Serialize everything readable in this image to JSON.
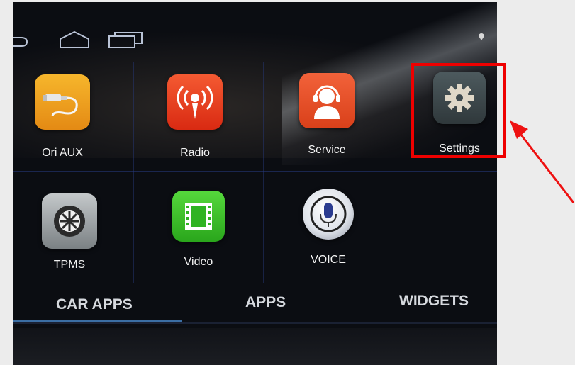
{
  "apps": [
    {
      "label": "Ori AUX",
      "icon": "aux-cable-icon",
      "color": "#f0a020"
    },
    {
      "label": "Radio",
      "icon": "radio-broadcast-icon",
      "color": "#ee3b1d"
    },
    {
      "label": "Service",
      "icon": "headset-support-icon",
      "color": "#e84e22"
    },
    {
      "label": "Settings",
      "icon": "gear-icon",
      "color": "#3f4a4e"
    },
    {
      "label": "TPMS",
      "icon": "tire-wheel-icon",
      "color": "#9aa0a3"
    },
    {
      "label": "Video",
      "icon": "film-icon",
      "color": "#3fc12c"
    },
    {
      "label": "VOICE",
      "icon": "microphone-icon",
      "color": "#d8dce3"
    }
  ],
  "tabs": [
    {
      "label": "CAR APPS",
      "selected": true
    },
    {
      "label": "APPS",
      "selected": false
    },
    {
      "label": "WIDGETS",
      "selected": false
    }
  ],
  "nav": [
    "back-icon",
    "home-icon",
    "recent-apps-icon"
  ],
  "annotation": {
    "highlight_color": "#ee0000",
    "target": "Settings"
  }
}
